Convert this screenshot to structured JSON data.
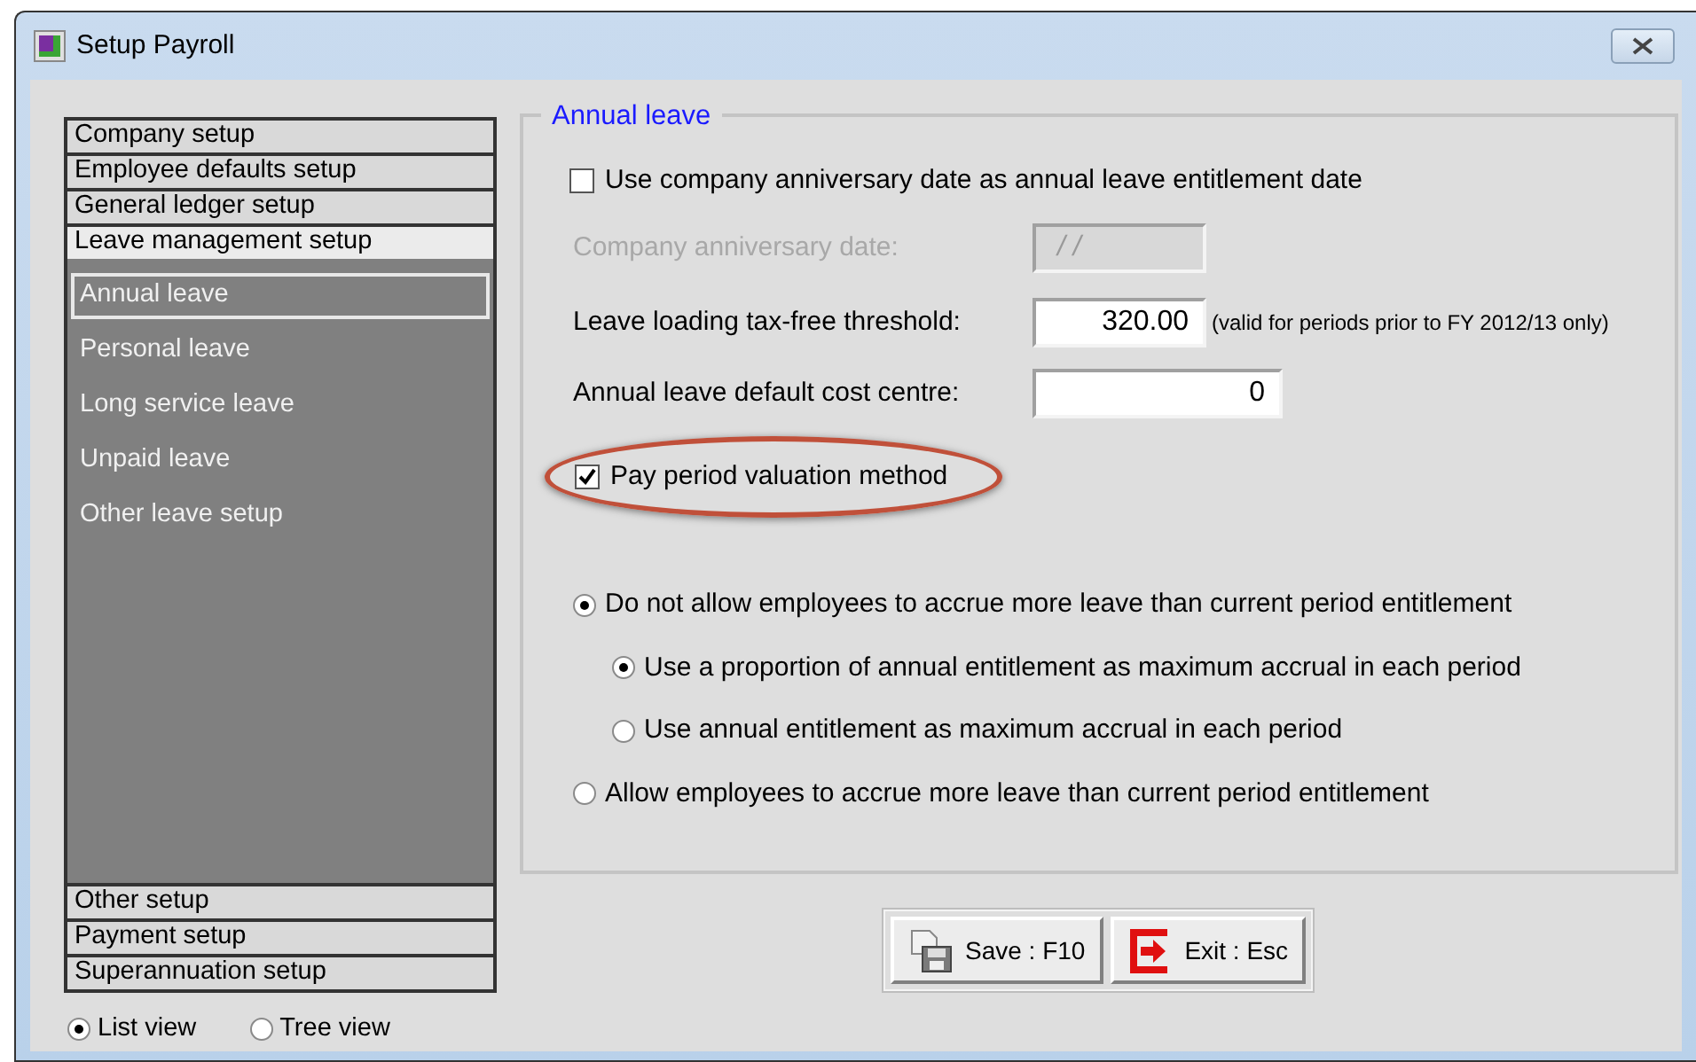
{
  "window": {
    "title": "Setup Payroll"
  },
  "sidebar": {
    "sections": [
      {
        "label": "Company setup",
        "expanded": false
      },
      {
        "label": "Employee defaults setup",
        "expanded": false
      },
      {
        "label": "General ledger setup",
        "expanded": false
      },
      {
        "label": "Leave management setup",
        "expanded": true,
        "children": [
          {
            "label": "Annual leave",
            "selected": true
          },
          {
            "label": "Personal leave",
            "selected": false
          },
          {
            "label": "Long service leave",
            "selected": false
          },
          {
            "label": "Unpaid leave",
            "selected": false
          },
          {
            "label": "Other leave setup",
            "selected": false
          }
        ]
      },
      {
        "label": "Other setup",
        "expanded": false
      },
      {
        "label": "Payment setup",
        "expanded": false
      },
      {
        "label": "Superannuation setup",
        "expanded": false
      }
    ]
  },
  "view_options": [
    {
      "label": "List view",
      "selected": true
    },
    {
      "label": "Tree view",
      "selected": false
    }
  ],
  "group": {
    "title": "Annual leave",
    "use_anniversary": {
      "label": "Use company anniversary date as annual leave entitlement date",
      "checked": false
    },
    "anniversary_date": {
      "label": "Company anniversary date:",
      "value": "/ /",
      "disabled": true
    },
    "threshold": {
      "label": "Leave loading tax-free threshold:",
      "value": "320.00",
      "note": "(valid for periods prior to FY 2012/13 only)"
    },
    "cost_centre": {
      "label": "Annual leave default cost centre:",
      "value": "0"
    },
    "pay_period": {
      "label": "Pay period valuation method",
      "checked": true,
      "highlighted": true
    },
    "accrual_options": [
      {
        "label": "Do not allow employees to accrue more leave than current period entitlement",
        "selected": true,
        "children": [
          {
            "label": "Use a proportion of annual entitlement as maximum accrual in each period",
            "selected": true
          },
          {
            "label": "Use annual entitlement as maximum accrual in each period",
            "selected": false
          }
        ]
      },
      {
        "label": "Allow employees to accrue more leave than current period entitlement",
        "selected": false
      }
    ]
  },
  "buttons": [
    {
      "label": "Save : F10",
      "kind": "save"
    },
    {
      "label": "Exit : Esc",
      "kind": "exit"
    }
  ]
}
